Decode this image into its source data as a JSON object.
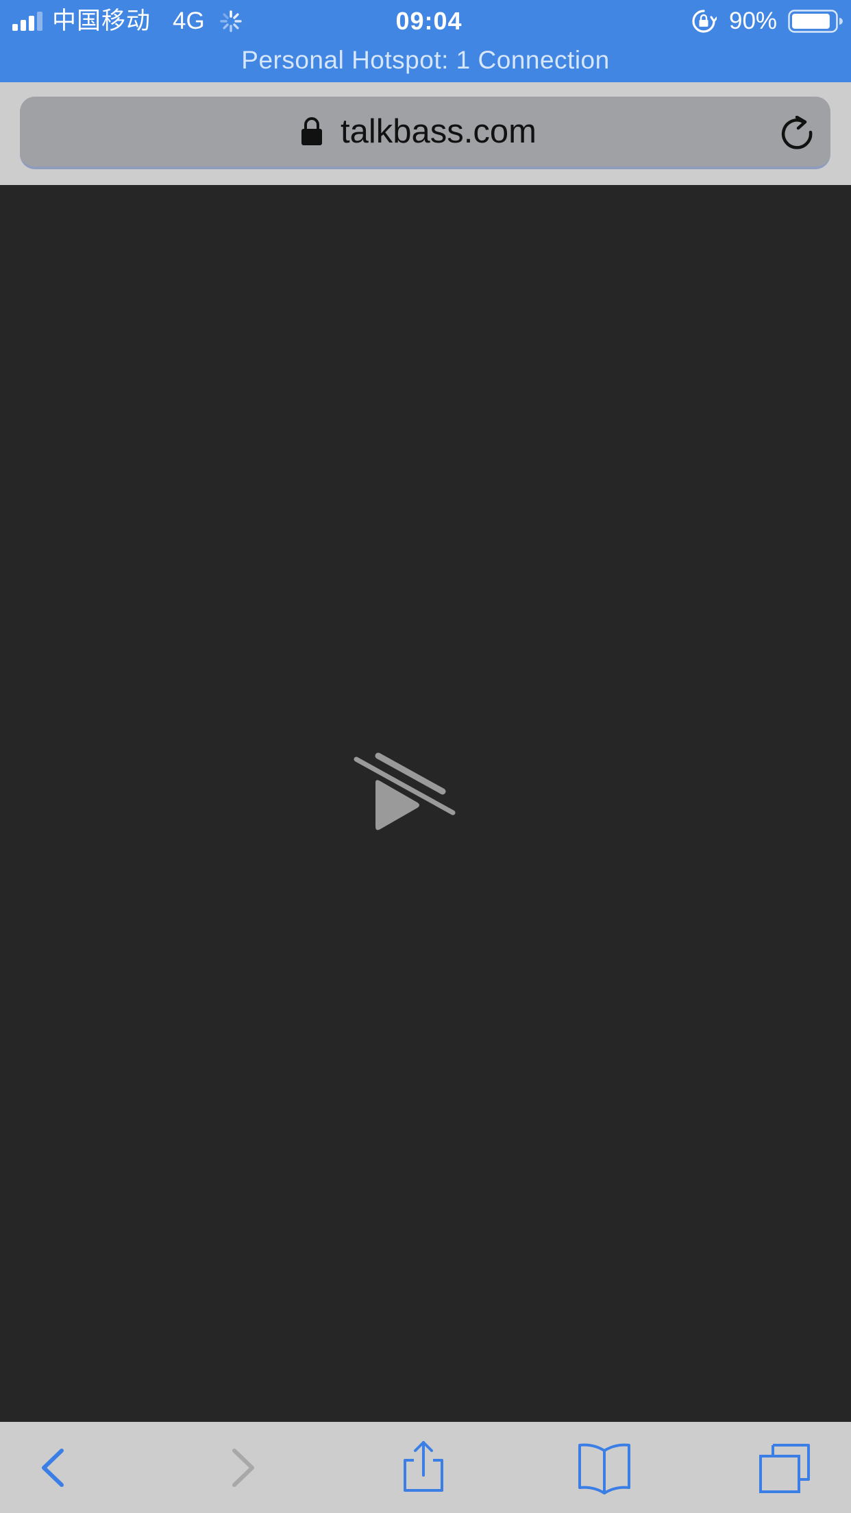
{
  "status_bar": {
    "carrier": "中国移动",
    "network": "4G",
    "time": "09:04",
    "battery_percent": "90%",
    "battery_level": 0.9,
    "signal_bars_filled": 3,
    "signal_bars_total": 4,
    "icons": [
      "signal-icon",
      "activity-spinner-icon",
      "rotation-lock-icon",
      "battery-icon"
    ]
  },
  "hotspot_banner": {
    "text": "Personal Hotspot: 1 Connection"
  },
  "address_bar": {
    "url": "talkbass.com",
    "secure": true,
    "icons": [
      "lock-icon",
      "reload-icon"
    ]
  },
  "content": {
    "icon": "autoplay-blocked-icon"
  },
  "toolbar": {
    "items": [
      {
        "name": "back",
        "icon": "chevron-left-icon",
        "enabled": true
      },
      {
        "name": "forward",
        "icon": "chevron-right-icon",
        "enabled": false
      },
      {
        "name": "share",
        "icon": "share-icon",
        "enabled": true
      },
      {
        "name": "bookmarks",
        "icon": "book-icon",
        "enabled": true
      },
      {
        "name": "tabs",
        "icon": "tabs-icon",
        "enabled": true
      }
    ]
  },
  "colors": {
    "status_bar_bg": "#4286e3",
    "toolbar_bg": "#cdcdcd",
    "address_field_bg": "#a0a1a5",
    "content_bg": "#262626",
    "accent": "#3a7ee6",
    "disabled": "#a8a8a8"
  }
}
